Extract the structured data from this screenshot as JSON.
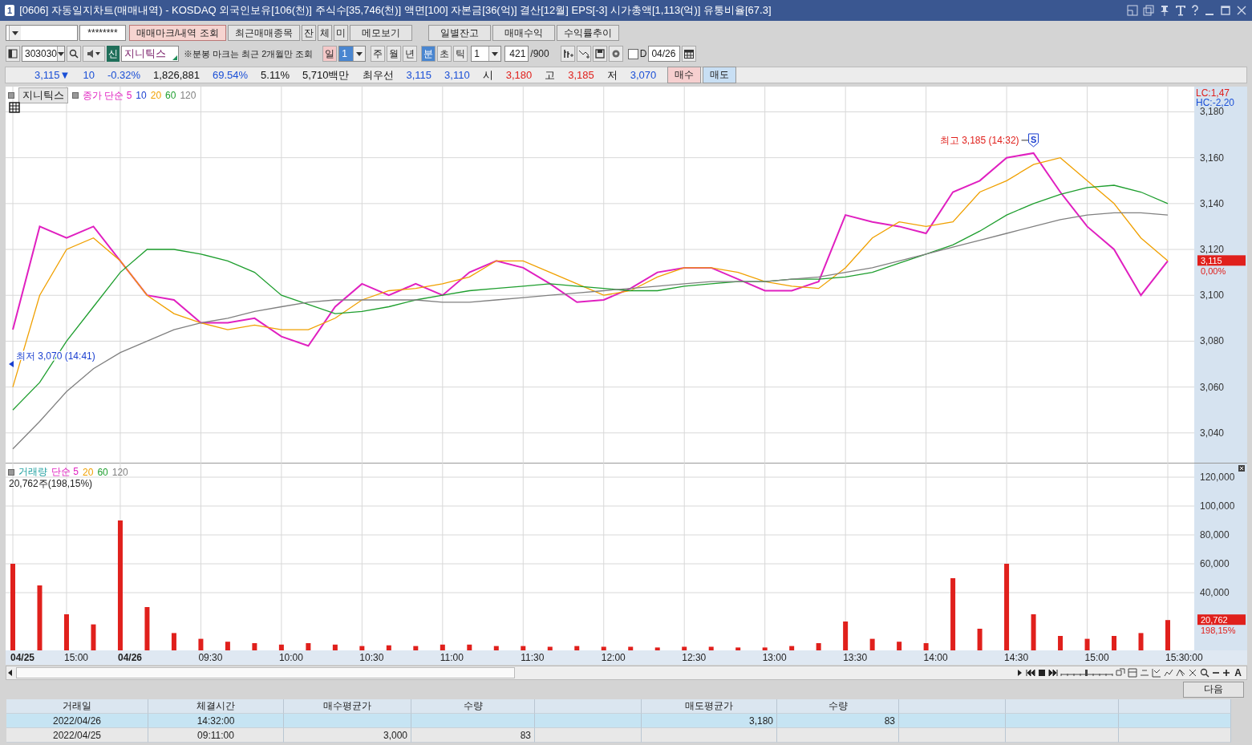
{
  "window": {
    "badge": "1",
    "title": "[0606] 자동일지차트(매매내역) - KOSDAQ 외국인보유[106(천)] 주식수[35,746(천)] 액면[100] 자본금[36(억)] 결산[12월] EPS[-3] 시가총액[1,113(억)] 유통비율[67.3]"
  },
  "toolbar": {
    "password": "********",
    "buttons": [
      {
        "label": "매매마크/내역 조회",
        "selected": true
      },
      {
        "label": "최근매매종목",
        "selected": false
      },
      {
        "label": "잔",
        "selected": false
      },
      {
        "label": "체",
        "selected": false
      },
      {
        "label": "미",
        "selected": false
      },
      {
        "label": "메모보기",
        "selected": false
      }
    ],
    "right_buttons": [
      "일별잔고",
      "매매수익",
      "수익률추이"
    ],
    "stock_code": "303030",
    "market_badge": "신",
    "stock_name": "지니틱스",
    "note": "※분봉 마크는 최근 2개월만 조회",
    "period_tabs": [
      {
        "label": "일",
        "selected": false,
        "marked": true
      },
      {
        "label": "주",
        "selected": false,
        "marked": false
      },
      {
        "label": "월",
        "selected": false,
        "marked": false
      },
      {
        "label": "년",
        "selected": false,
        "marked": false
      },
      {
        "label": "분",
        "selected": true,
        "marked": false
      },
      {
        "label": "초",
        "selected": false,
        "marked": false
      },
      {
        "label": "틱",
        "selected": false,
        "marked": false
      }
    ],
    "day_count": "1",
    "interval": "1",
    "count": "421",
    "count_max": "/900",
    "d_checkbox": {
      "label": "D",
      "checked": false
    },
    "date": "04/26"
  },
  "quote": {
    "items": [
      {
        "text": "3,115▼",
        "color": "#1a4fd6"
      },
      {
        "text": "10",
        "color": "#1a4fd6"
      },
      {
        "text": "-0.32%",
        "color": "#1a4fd6"
      },
      {
        "text": "1,826,881"
      },
      {
        "text": "69.54%",
        "color": "#1a4fd6"
      },
      {
        "text": "5.11%"
      },
      {
        "text": "5,710백만"
      },
      {
        "text": "최우선"
      },
      {
        "text": "3,115",
        "color": "#1a4fd6"
      },
      {
        "text": "3,110",
        "color": "#1a4fd6"
      },
      {
        "text": "시"
      },
      {
        "text": "3,180",
        "color": "#e0201c"
      },
      {
        "text": "고"
      },
      {
        "text": "3,185",
        "color": "#e0201c"
      },
      {
        "text": "저"
      },
      {
        "text": "3,070",
        "color": "#1a4fd6"
      }
    ],
    "buy_button": "매수",
    "sell_button": "매도"
  },
  "price_chart": {
    "legend": {
      "button": "지니틱스",
      "extra": {
        "text": "10",
        "color": "#1a3fd0"
      }
    },
    "signal_marker": "S",
    "lc": "LC:1,47",
    "hc": "HC:-2,20",
    "price_tag": "3,115",
    "change_tag": "0,00%",
    "chart_data": {
      "type": "line",
      "grid": true,
      "ylim": [
        3027,
        3191
      ],
      "categories": [
        null,
        null,
        null,
        null,
        null,
        null,
        null,
        null,
        null,
        null,
        null,
        null,
        null,
        null,
        null,
        null,
        null,
        null,
        null,
        null,
        null,
        null,
        null,
        null,
        null,
        null,
        null,
        null,
        null,
        null,
        null,
        null,
        null,
        null,
        null,
        null,
        null,
        null,
        null,
        null,
        null,
        null,
        null,
        null
      ],
      "yticks": [
        {
          "value": 3040,
          "label": "3,040"
        },
        {
          "value": 3060,
          "label": "3,060"
        },
        {
          "value": 3080,
          "label": "3,080"
        },
        {
          "value": 3100,
          "label": "3,100"
        },
        {
          "value": 3120,
          "label": "3,120"
        },
        {
          "value": 3140,
          "label": "3,140"
        },
        {
          "value": 3160,
          "label": "3,160"
        },
        {
          "value": 3180,
          "label": "3,180"
        }
      ],
      "series": [
        {
          "name": "종가 단순 5",
          "color": "#e020c0",
          "values": [
            3085,
            3130,
            3125,
            3130,
            3115,
            3100,
            3098,
            3088,
            3088,
            3090,
            3082,
            3078,
            3095,
            3105,
            3100,
            3105,
            3100,
            3110,
            3115,
            3112,
            3105,
            3097,
            3098,
            3103,
            3110,
            3112,
            3112,
            3107,
            3102,
            3102,
            3106,
            3135,
            3132,
            3130,
            3127,
            3145,
            3150,
            3160,
            3162,
            3145,
            3130,
            3120,
            3100,
            3115
          ]
        },
        {
          "name": "20",
          "color": "#f0a000",
          "values": [
            3060,
            3100,
            3120,
            3125,
            3115,
            3100,
            3092,
            3088,
            3085,
            3087,
            3085,
            3085,
            3090,
            3098,
            3102,
            3103,
            3105,
            3108,
            3115,
            3115,
            3110,
            3105,
            3100,
            3102,
            3108,
            3112,
            3112,
            3110,
            3106,
            3104,
            3103,
            3112,
            3125,
            3132,
            3130,
            3132,
            3145,
            3150,
            3157,
            3160,
            3150,
            3140,
            3125,
            3115
          ]
        },
        {
          "name": "60",
          "color": "#1e9e2e",
          "values": [
            3050,
            3062,
            3080,
            3095,
            3110,
            3120,
            3120,
            3118,
            3115,
            3110,
            3100,
            3096,
            3092,
            3093,
            3095,
            3098,
            3100,
            3102,
            3103,
            3104,
            3105,
            3104,
            3103,
            3102,
            3102,
            3104,
            3105,
            3106,
            3106,
            3107,
            3107,
            3108,
            3110,
            3114,
            3118,
            3122,
            3128,
            3135,
            3140,
            3144,
            3147,
            3148,
            3145,
            3140
          ]
        },
        {
          "name": "120",
          "color": "#808080",
          "values": [
            3033,
            3045,
            3058,
            3068,
            3075,
            3080,
            3085,
            3088,
            3090,
            3093,
            3095,
            3097,
            3098,
            3098,
            3098,
            3098,
            3097,
            3097,
            3098,
            3099,
            3100,
            3101,
            3102,
            3103,
            3104,
            3105,
            3106,
            3106,
            3106,
            3107,
            3108,
            3110,
            3112,
            3115,
            3118,
            3121,
            3124,
            3127,
            3130,
            3133,
            3135,
            3136,
            3136,
            3135
          ]
        }
      ],
      "annotations": [
        {
          "text": "최고 3,185 (14:32)"
        },
        {
          "text": "최저 3,070 (14:41)"
        }
      ]
    }
  },
  "volume_chart": {
    "legend": {
      "color": "#20a0a0",
      "extra_items": [
        {
          "text": "단순 5",
          "color": "#e020c0"
        },
        {
          "text": "20",
          "color": "#f0a000"
        },
        {
          "text": "60",
          "color": "#1e9e2e"
        },
        {
          "text": "120",
          "color": "#808080"
        }
      ]
    },
    "readout": "20,762주(198,15%)",
    "volume_tag": "20,762",
    "ratio_tag": "198,15%",
    "chart_data": {
      "type": "bar",
      "grid": true,
      "ylim": [
        0,
        130000
      ],
      "categories": [
        "04/25",
        null,
        "15:00",
        null,
        "04/26",
        null,
        null,
        "09:30",
        null,
        null,
        "10:00",
        null,
        null,
        "10:30",
        null,
        null,
        "11:00",
        null,
        null,
        "11:30",
        null,
        null,
        "12:00",
        null,
        null,
        "12:30",
        null,
        null,
        "13:00",
        null,
        null,
        "13:30",
        null,
        null,
        "14:00",
        null,
        null,
        "14:30",
        null,
        null,
        "15:00",
        null,
        null,
        "15:30:00"
      ],
      "yticks": [
        {
          "value": 40000,
          "label": "40,000"
        },
        {
          "value": 60000,
          "label": "60,000"
        },
        {
          "value": 80000,
          "label": "80,000"
        },
        {
          "value": 100000,
          "label": "100,000"
        },
        {
          "value": 120000,
          "label": "120,000"
        }
      ],
      "series": [
        {
          "name": "거래량",
          "color": "#e0201c",
          "values": [
            60000,
            45000,
            25000,
            18000,
            90000,
            30000,
            12000,
            8000,
            6000,
            5000,
            4000,
            5000,
            4000,
            3000,
            3500,
            3000,
            4000,
            4000,
            3000,
            3000,
            2500,
            3000,
            2500,
            2500,
            2000,
            2500,
            2500,
            2000,
            2000,
            3000,
            5000,
            20000,
            8000,
            6000,
            5000,
            50000,
            15000,
            60000,
            25000,
            10000,
            8000,
            10000,
            12000,
            21000
          ]
        }
      ]
    }
  },
  "scroll_bar": {
    "font_button": "A"
  },
  "next_button": "다음",
  "table": {
    "columns": [
      "거래일",
      "체결시간",
      "매수평균가",
      "수량",
      "매도평균가",
      "수량"
    ],
    "rows": [
      {
        "selected": true,
        "cells": [
          "2022/04/26",
          "14:32:00",
          null,
          null,
          "3,180",
          "83"
        ]
      },
      {
        "selected": false,
        "cells": [
          "2022/04/25",
          "09:11:00",
          "3,000",
          "83",
          null,
          null
        ]
      }
    ]
  }
}
